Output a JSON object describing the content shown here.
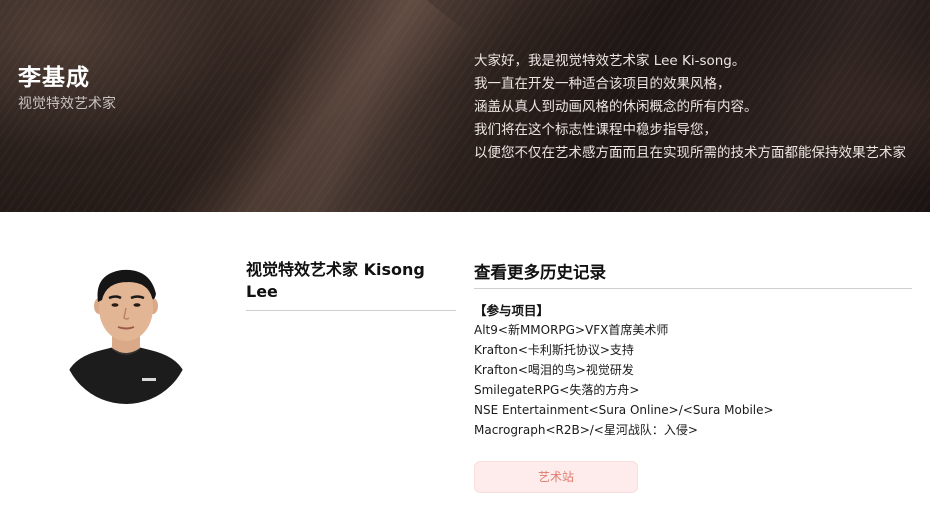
{
  "hero": {
    "name": "李基成",
    "role": "视觉特效艺术家",
    "intro_lines": [
      "大家好，我是视觉特效艺术家 Lee Ki-song。",
      "我一直在开发一种适合该项目的效果风格，",
      "涵盖从真人到动画风格的休闲概念的所有内容。",
      "我们将在这个标志性课程中稳步指导您，",
      "以便您不仅在艺术感方面而且在实现所需的技术方面都能保持效果艺术家"
    ]
  },
  "profile": {
    "title": "视觉特效艺术家 Kisong Lee"
  },
  "history": {
    "title": "查看更多历史记录",
    "projects_heading": "【参与项目】",
    "projects": [
      "Alt9<新MMORPG>VFX首席美术师",
      "Krafton<卡利斯托协议>支持",
      "Krafton<喝泪的鸟>视觉研发",
      "SmilegateRPG<失落的方舟>",
      "NSE Entertainment<Sura Online>/<Sura Mobile>",
      "Macrograph<R2B>/<星河战队：入侵>"
    ],
    "button_label": "艺术站"
  },
  "colors": {
    "accent_button_bg": "#fdeceb",
    "accent_button_text": "#e07b6e",
    "hero_text": "#ffffff"
  }
}
